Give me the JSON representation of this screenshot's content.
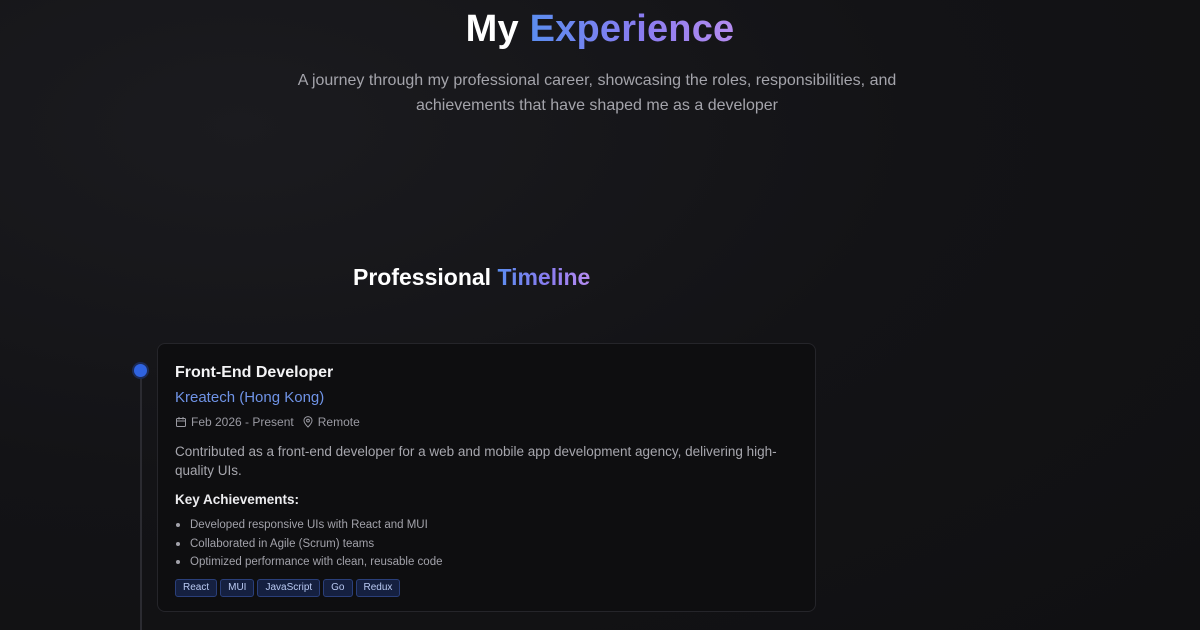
{
  "hero": {
    "title_plain": "My",
    "title_accent": "Experience",
    "subtitle": "A journey through my professional career, showcasing the roles, responsibilities, and achievements that have shaped me as a developer"
  },
  "timeline": {
    "title_plain": "Professional",
    "title_accent": "Timeline"
  },
  "job": {
    "role": "Front-End Developer",
    "company": "Kreatech (Hong Kong)",
    "dates": "Feb 2026 - Present",
    "location": "Remote",
    "description": "Contributed as a front-end developer for a web and mobile app development agency, delivering high-quality UIs.",
    "achievements_title": "Key Achievements:",
    "achievements": [
      "Developed responsive UIs with React and MUI",
      "Collaborated in Agile (Scrum) teams",
      "Optimized performance with clean, reusable code"
    ],
    "tags": [
      "React",
      "MUI",
      "JavaScript",
      "Go",
      "Redux"
    ]
  },
  "icons": {
    "calendar": "calendar-icon",
    "location": "map-pin-icon"
  },
  "colors": {
    "background": "#121214",
    "accent_blue": "#5b8def",
    "accent_purple": "#b58cf0",
    "timeline_dot": "#2f63e0",
    "company_link": "#6f93e6"
  }
}
